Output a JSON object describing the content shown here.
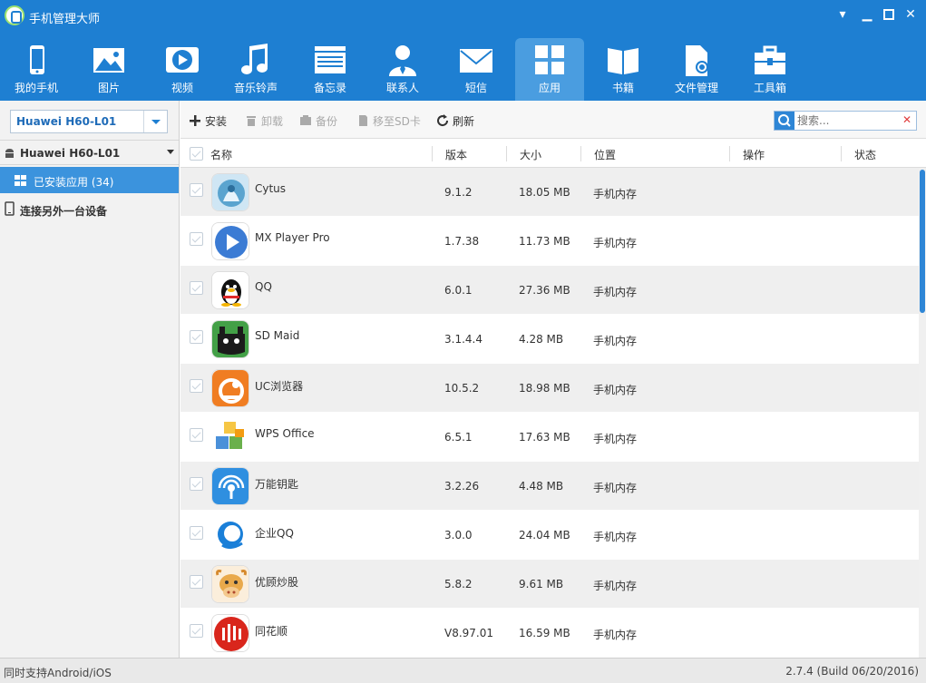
{
  "window": {
    "title": "手机管理大师",
    "controls": [
      "menu",
      "minimize",
      "maximize",
      "close"
    ]
  },
  "nav": {
    "active": "应用",
    "items": [
      {
        "label": "我的手机",
        "icon": "phone-icon"
      },
      {
        "label": "图片",
        "icon": "picture-icon"
      },
      {
        "label": "视频",
        "icon": "video-icon"
      },
      {
        "label": "音乐铃声",
        "icon": "music-icon"
      },
      {
        "label": "备忘录",
        "icon": "memo-icon"
      },
      {
        "label": "联系人",
        "icon": "contact-icon"
      },
      {
        "label": "短信",
        "icon": "mail-icon"
      },
      {
        "label": "应用",
        "icon": "apps-icon"
      },
      {
        "label": "书籍",
        "icon": "book-icon"
      },
      {
        "label": "文件管理",
        "icon": "file-gear-icon"
      },
      {
        "label": "工具箱",
        "icon": "toolbox-icon"
      }
    ]
  },
  "sidebar": {
    "device_select": "Huawei H60-L01",
    "device_header": "Huawei H60-L01",
    "installed_apps": "已安装应用 (34)",
    "connect_other": "连接另外一台设备"
  },
  "toolbar": {
    "install": "安装",
    "uninstall": "卸载",
    "backup": "备份",
    "move_sd": "移至SD卡",
    "refresh": "刷新",
    "search_placeholder": "搜索..."
  },
  "table": {
    "columns": [
      "名称",
      "版本",
      "大小",
      "位置",
      "操作",
      "状态"
    ],
    "rows": [
      {
        "name": "Cytus",
        "version": "9.1.2",
        "size": "18.05 MB",
        "location": "手机内存",
        "icon": "cytus-icon"
      },
      {
        "name": "MX Player Pro",
        "version": "1.7.38",
        "size": "11.73 MB",
        "location": "手机内存",
        "icon": "mx-player-icon"
      },
      {
        "name": "QQ",
        "version": "6.0.1",
        "size": "27.36 MB",
        "location": "手机内存",
        "icon": "qq-penguin-icon"
      },
      {
        "name": "SD Maid",
        "version": "3.1.4.4",
        "size": "4.28 MB",
        "location": "手机内存",
        "icon": "sd-maid-icon"
      },
      {
        "name": "UC浏览器",
        "version": "10.5.2",
        "size": "18.98 MB",
        "location": "手机内存",
        "icon": "uc-browser-icon"
      },
      {
        "name": "WPS Office",
        "version": "6.5.1",
        "size": "17.63 MB",
        "location": "手机内存",
        "icon": "wps-office-icon"
      },
      {
        "name": "万能钥匙",
        "version": "3.2.26",
        "size": "4.48 MB",
        "location": "手机内存",
        "icon": "wifi-key-icon"
      },
      {
        "name": "企业QQ",
        "version": "3.0.0",
        "size": "24.04 MB",
        "location": "手机内存",
        "icon": "enterprise-qq-icon"
      },
      {
        "name": "优顾炒股",
        "version": "5.8.2",
        "size": "9.61 MB",
        "location": "手机内存",
        "icon": "cow-icon"
      },
      {
        "name": "同花顺",
        "version": "V8.97.01",
        "size": "16.59 MB",
        "location": "手机内存",
        "icon": "stock-chart-icon"
      }
    ]
  },
  "statusbar": {
    "left": "同时支持Android/iOS",
    "right": "2.7.4 (Build 06/20/2016)"
  },
  "colors": {
    "header_blue": "#1e7fd2",
    "active_tab": "#4a9de0",
    "sidebar_selected": "#3b93dd"
  }
}
